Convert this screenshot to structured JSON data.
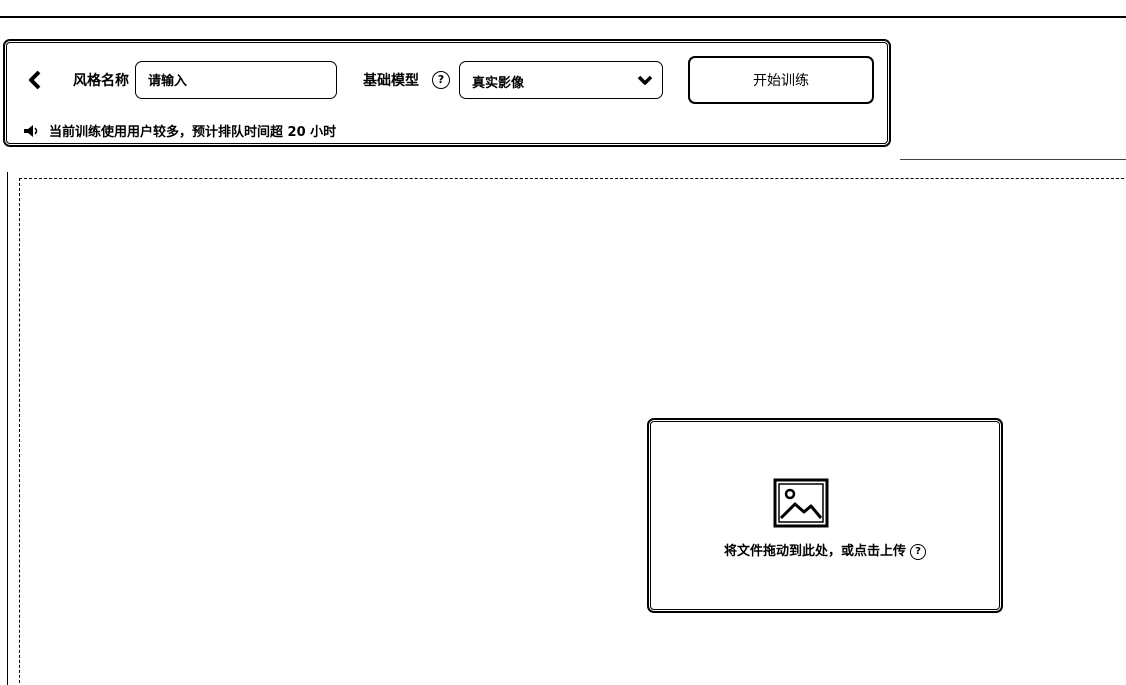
{
  "form": {
    "style_name_label": "风格名称",
    "style_name_placeholder": "请输入",
    "base_model_label": "基础模型",
    "base_model_value": "真实影像",
    "start_button": "开始训练",
    "notice": "当前训练使用用户较多，预计排队时间超 20 小时",
    "help_glyph": "?"
  },
  "upload": {
    "prompt": "将文件拖动到此处，或点击上传",
    "help_glyph": "?"
  }
}
